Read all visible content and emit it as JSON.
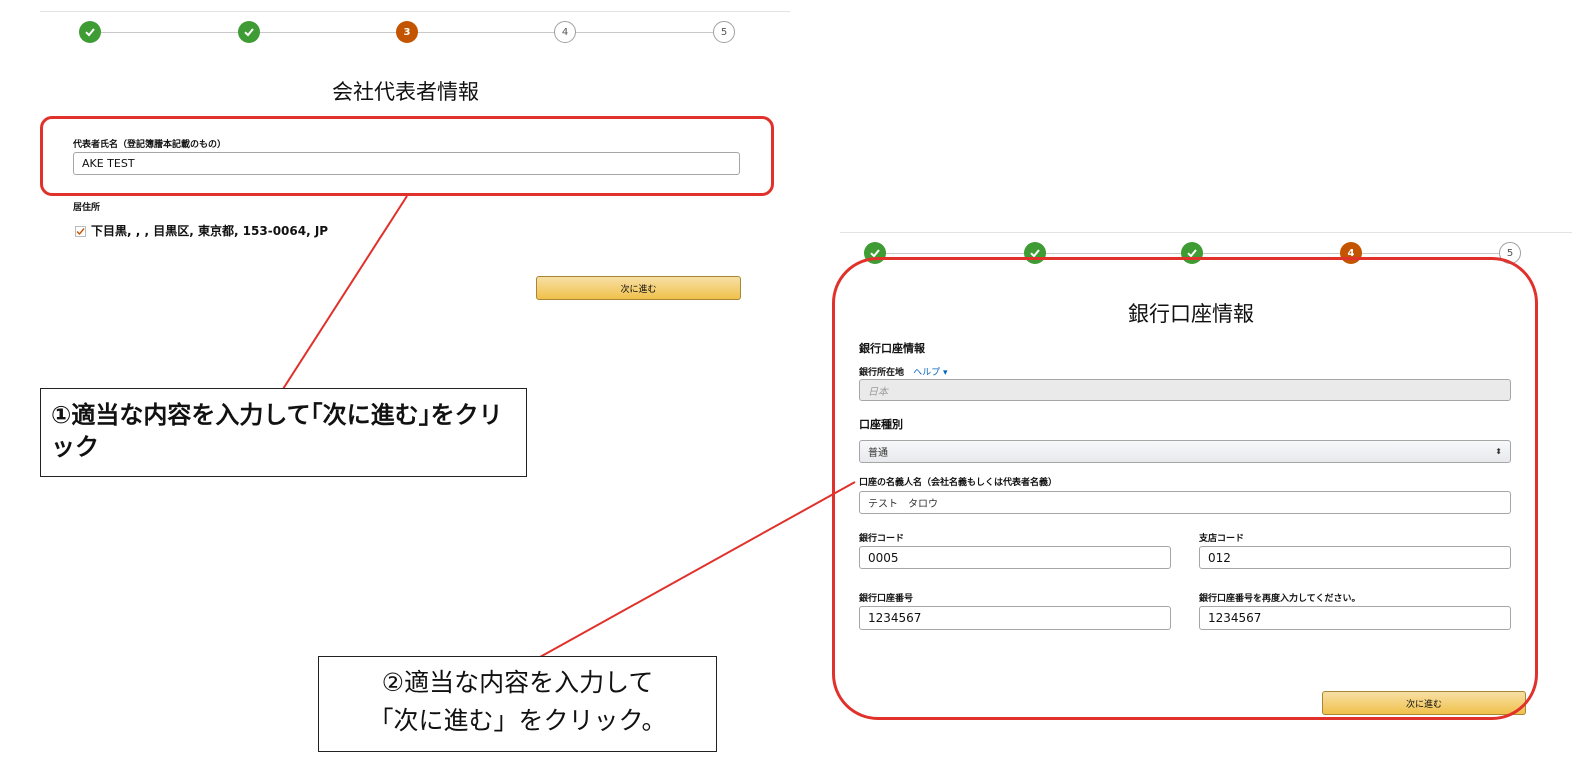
{
  "left_screen": {
    "steps": [
      {
        "state": "done"
      },
      {
        "state": "done"
      },
      {
        "state": "current",
        "label": "3"
      },
      {
        "state": "todo",
        "label": "4"
      },
      {
        "state": "todo",
        "label": "5"
      }
    ],
    "title": "会社代表者情報",
    "representative_name": {
      "label": "代表者氏名（登記簿謄本記載のもの）",
      "value": "AKE TEST"
    },
    "residence": {
      "label": "居住所",
      "address": "下目黒, , , 目黒区, 東京都, 153-0064, JP"
    },
    "next_button": "次に進む"
  },
  "right_screen": {
    "steps": [
      {
        "state": "done"
      },
      {
        "state": "done"
      },
      {
        "state": "done"
      },
      {
        "state": "current",
        "label": "4"
      },
      {
        "state": "todo",
        "label": "5"
      }
    ],
    "title": "銀行口座情報",
    "section_heading": "銀行口座情報",
    "bank_location": {
      "label": "銀行所在地",
      "help_link": "ヘルプ ▾",
      "value": "日本"
    },
    "account_type": {
      "label": "口座種別",
      "selected": "普通"
    },
    "account_holder": {
      "label": "口座の名義人名（会社名義もしくは代表者名義）",
      "value": "テスト　タロウ"
    },
    "bank_code": {
      "label": "銀行コード",
      "value": "0005"
    },
    "branch_code": {
      "label": "支店コード",
      "value": "012"
    },
    "account_number": {
      "label": "銀行口座番号",
      "value": "1234567"
    },
    "account_number_confirm": {
      "label": "銀行口座番号を再度入力してください。",
      "value": "1234567"
    },
    "next_button": "次に進む"
  },
  "callouts": {
    "first": "①適当な内容を入力して｢次に進む｣をクリック",
    "second_line1": "②適当な内容を入力して",
    "second_line2": "「次に進む」をクリック。"
  },
  "colors": {
    "annotation_red": "#e0312b",
    "step_done": "#3f9c35",
    "step_current": "#c45500",
    "button": "#f0c14b"
  }
}
